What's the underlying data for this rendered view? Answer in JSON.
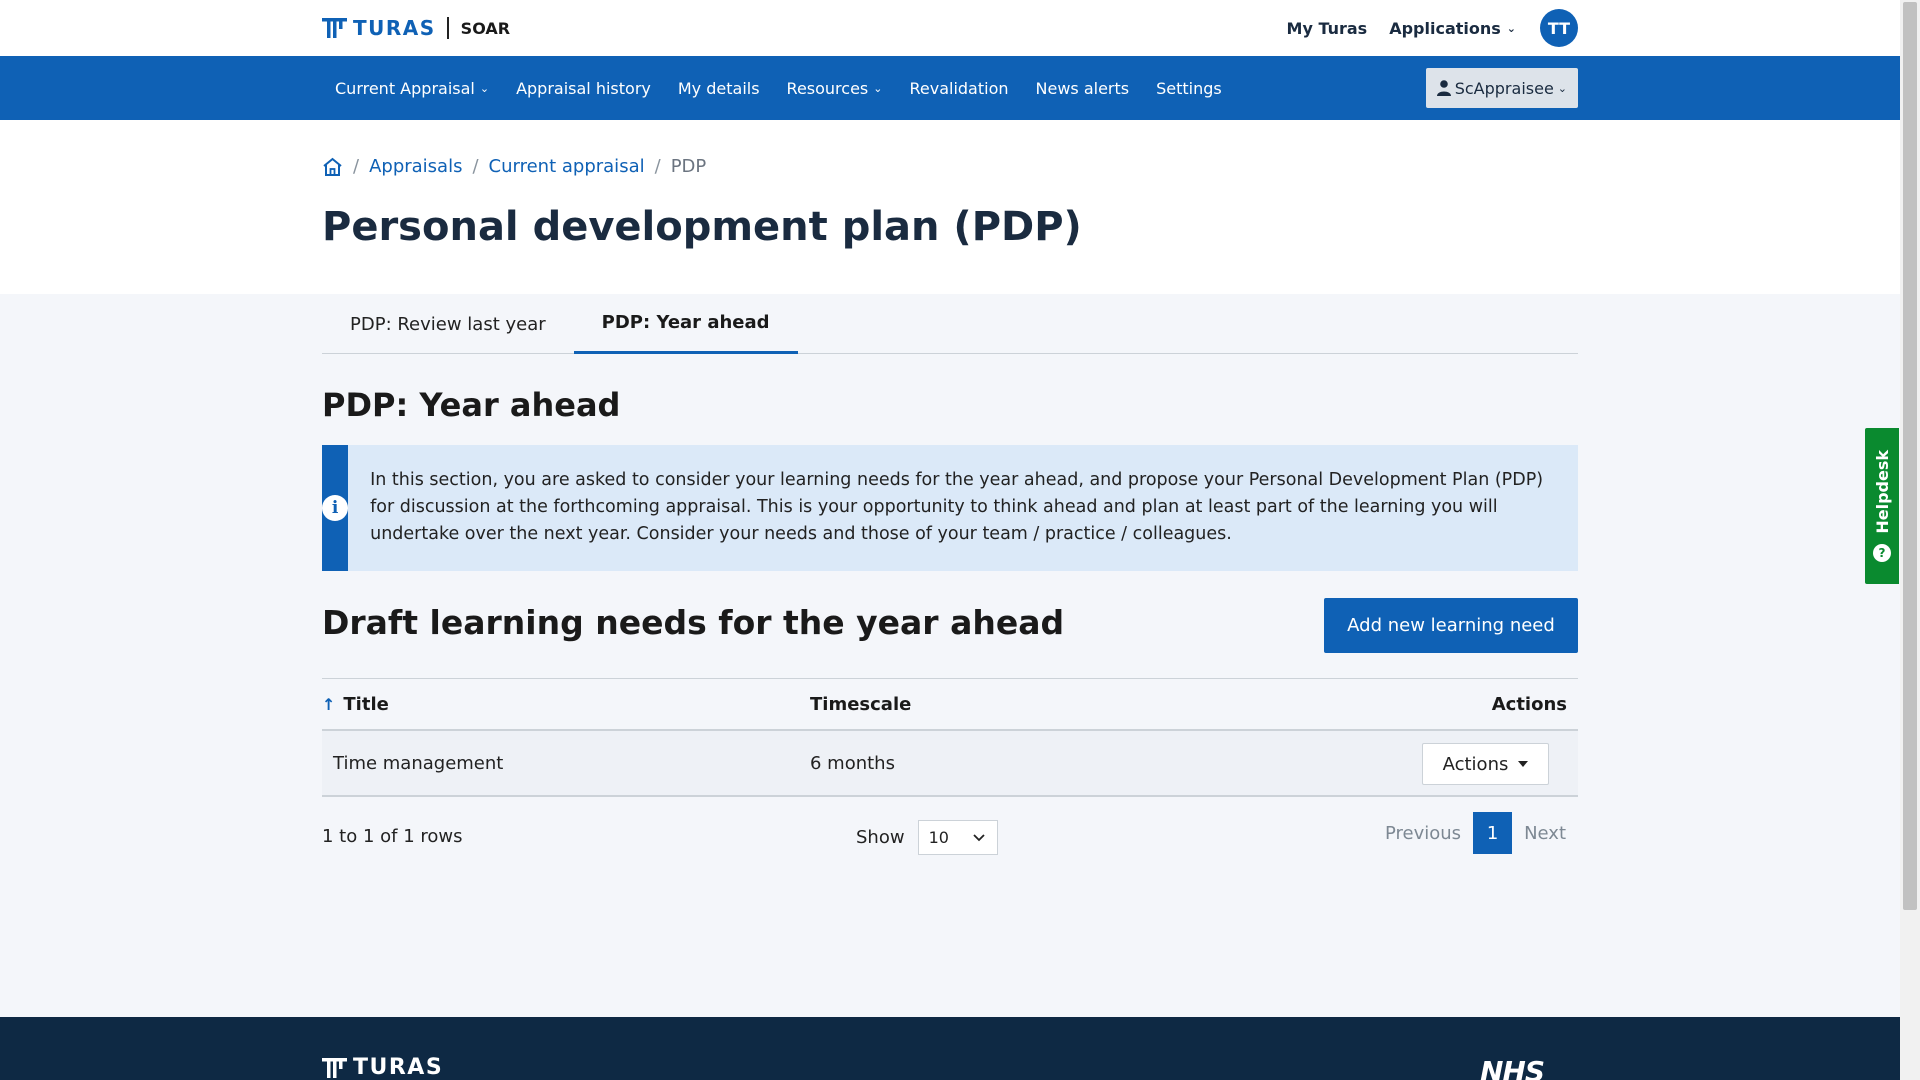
{
  "brand": {
    "name": "TURAS",
    "app": "SOAR"
  },
  "top_links": {
    "my_turas": "My Turas",
    "applications": "Applications",
    "avatar_initials": "TT"
  },
  "nav": {
    "items": [
      {
        "label": "Current Appraisal",
        "dropdown": true
      },
      {
        "label": "Appraisal history",
        "dropdown": false
      },
      {
        "label": "My details",
        "dropdown": false
      },
      {
        "label": "Resources",
        "dropdown": true
      },
      {
        "label": "Revalidation",
        "dropdown": false
      },
      {
        "label": "News alerts",
        "dropdown": false
      },
      {
        "label": "Settings",
        "dropdown": false
      }
    ],
    "user_label": "ScAppraisee"
  },
  "breadcrumb": {
    "appraisals": "Appraisals",
    "current_appraisal": "Current appraisal",
    "current": "PDP"
  },
  "page_title": "Personal development plan (PDP)",
  "tabs": [
    {
      "label": "PDP: Review last year",
      "active": false
    },
    {
      "label": "PDP: Year ahead",
      "active": true
    }
  ],
  "section_title": "PDP: Year ahead",
  "info_text": "In this section, you are asked to consider your learning needs for the year ahead, and propose your Personal Development Plan (PDP) for discussion at the forthcoming appraisal. This is your opportunity to think ahead and plan at least part of the learning you will undertake over the next year. Consider your needs and those of your team / practice / colleagues.",
  "learning_needs": {
    "title": "Draft learning needs for the year ahead",
    "add_button": "Add new learning need",
    "columns": {
      "title": "Title",
      "timescale": "Timescale",
      "actions": "Actions"
    },
    "rows": [
      {
        "title": "Time management",
        "timescale": "6 months",
        "actions_label": "Actions"
      }
    ],
    "row_count_text": "1 to 1 of 1 rows",
    "show_label": "Show",
    "page_size": "10",
    "pagination": {
      "previous": "Previous",
      "current_page": "1",
      "next": "Next"
    }
  },
  "footer": {
    "brand": "TURAS",
    "nhs": "NHS"
  },
  "helpdesk_label": "Helpdesk",
  "colors": {
    "primary": "#0f61b5",
    "footer": "#0e2944",
    "helpdesk": "#0a8a2f",
    "info_bg": "#dbe9f8"
  }
}
